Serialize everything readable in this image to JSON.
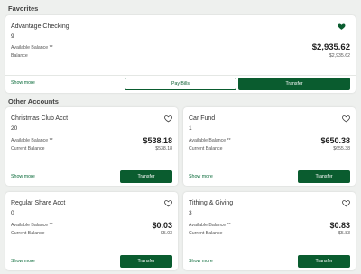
{
  "sections": {
    "favorites_title": "Favorites",
    "other_title": "Other Accounts"
  },
  "colors": {
    "brand_green": "#0a5c2f",
    "page_bg": "#eef0ee"
  },
  "labels": {
    "available_balance": "Available Balance **",
    "balance": "Balance",
    "current_balance": "Current Balance",
    "show_more": "Show more",
    "pay_bills": "Pay Bills",
    "transfer": "Transfer"
  },
  "favorite": {
    "name": "Advantage Checking",
    "number": "9",
    "available": "$2,935.62",
    "balance": "$2,935.62",
    "favorited": true
  },
  "accounts": [
    {
      "name": "Christmas Club Acct",
      "number": "20",
      "available": "$538.18",
      "current": "$538.18",
      "favorited": false
    },
    {
      "name": "Car Fund",
      "number": "1",
      "available": "$650.38",
      "current": "$655.38",
      "favorited": false
    },
    {
      "name": "Regular Share Acct",
      "number": "0",
      "available": "$0.03",
      "current": "$5.03",
      "favorited": false
    },
    {
      "name": "Tithing & Giving",
      "number": "3",
      "available": "$0.83",
      "current": "$5.83",
      "favorited": false
    }
  ]
}
